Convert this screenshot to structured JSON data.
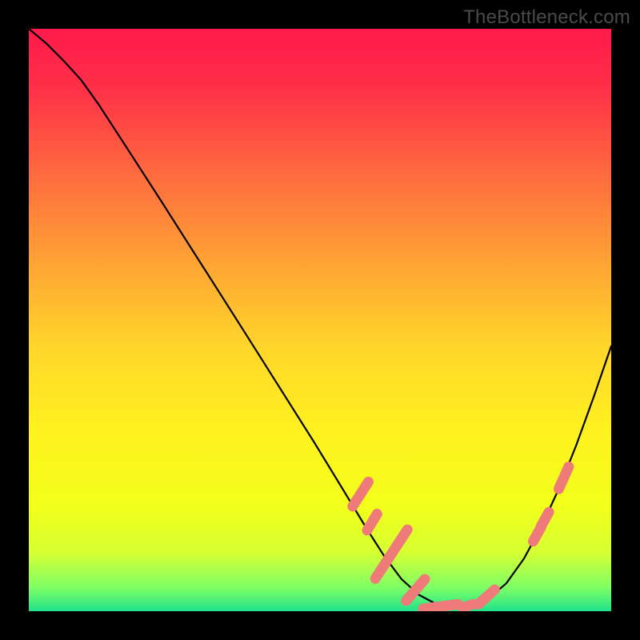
{
  "watermark": "TheBottleneck.com",
  "chart_data": {
    "type": "line",
    "title": "",
    "xlabel": "",
    "ylabel": "",
    "xlim": [
      0,
      1
    ],
    "ylim": [
      0,
      1
    ],
    "gradient_stops": [
      {
        "offset": 0.0,
        "color": "#ff1a4a"
      },
      {
        "offset": 0.1,
        "color": "#ff2f48"
      },
      {
        "offset": 0.25,
        "color": "#ff6b3e"
      },
      {
        "offset": 0.4,
        "color": "#ffa334"
      },
      {
        "offset": 0.55,
        "color": "#ffd72a"
      },
      {
        "offset": 0.7,
        "color": "#fff31f"
      },
      {
        "offset": 0.82,
        "color": "#f2ff1a"
      },
      {
        "offset": 0.9,
        "color": "#d6ff33"
      },
      {
        "offset": 0.96,
        "color": "#7dff66"
      },
      {
        "offset": 1.0,
        "color": "#21e18c"
      }
    ],
    "curve": [
      {
        "x": 0.0,
        "y": 1.0
      },
      {
        "x": 0.03,
        "y": 0.975
      },
      {
        "x": 0.06,
        "y": 0.945
      },
      {
        "x": 0.09,
        "y": 0.912
      },
      {
        "x": 0.12,
        "y": 0.87
      },
      {
        "x": 0.17,
        "y": 0.793
      },
      {
        "x": 0.23,
        "y": 0.7
      },
      {
        "x": 0.3,
        "y": 0.59
      },
      {
        "x": 0.37,
        "y": 0.48
      },
      {
        "x": 0.43,
        "y": 0.385
      },
      {
        "x": 0.49,
        "y": 0.29
      },
      {
        "x": 0.54,
        "y": 0.208
      },
      {
        "x": 0.58,
        "y": 0.142
      },
      {
        "x": 0.61,
        "y": 0.095
      },
      {
        "x": 0.64,
        "y": 0.055
      },
      {
        "x": 0.67,
        "y": 0.028
      },
      {
        "x": 0.7,
        "y": 0.012
      },
      {
        "x": 0.73,
        "y": 0.005
      },
      {
        "x": 0.76,
        "y": 0.008
      },
      {
        "x": 0.79,
        "y": 0.022
      },
      {
        "x": 0.82,
        "y": 0.048
      },
      {
        "x": 0.85,
        "y": 0.09
      },
      {
        "x": 0.88,
        "y": 0.145
      },
      {
        "x": 0.91,
        "y": 0.21
      },
      {
        "x": 0.94,
        "y": 0.285
      },
      {
        "x": 0.97,
        "y": 0.368
      },
      {
        "x": 1.0,
        "y": 0.455
      }
    ],
    "highlight_pills": [
      {
        "x0": 0.556,
        "x1": 0.583,
        "y0": 0.18,
        "y1": 0.222
      },
      {
        "x0": 0.581,
        "x1": 0.598,
        "y0": 0.139,
        "y1": 0.167
      },
      {
        "x0": 0.595,
        "x1": 0.65,
        "y0": 0.056,
        "y1": 0.14
      },
      {
        "x0": 0.648,
        "x1": 0.68,
        "y0": 0.018,
        "y1": 0.055
      },
      {
        "x0": 0.677,
        "x1": 0.737,
        "y0": 0.004,
        "y1": 0.012
      },
      {
        "x0": 0.745,
        "x1": 0.763,
        "y0": 0.006,
        "y1": 0.012
      },
      {
        "x0": 0.772,
        "x1": 0.8,
        "y0": 0.012,
        "y1": 0.037
      },
      {
        "x0": 0.866,
        "x1": 0.88,
        "y0": 0.12,
        "y1": 0.145
      },
      {
        "x0": 0.879,
        "x1": 0.893,
        "y0": 0.145,
        "y1": 0.17
      },
      {
        "x0": 0.91,
        "x1": 0.927,
        "y0": 0.21,
        "y1": 0.248
      }
    ],
    "highlight_color": "#ee7a7a"
  }
}
